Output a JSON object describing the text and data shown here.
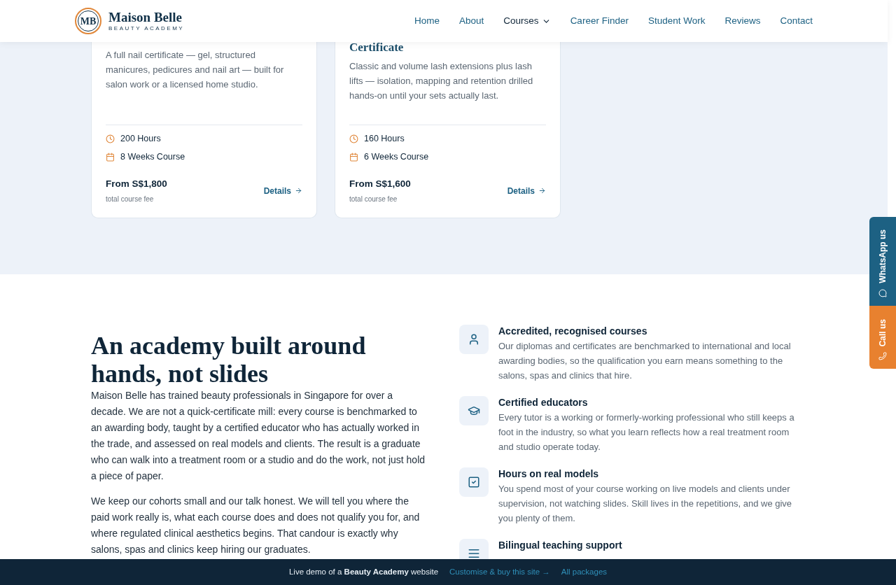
{
  "header": {
    "logo_mark": "MB",
    "brand": "Maison Belle",
    "tagline": "BEAUTY ACADEMY",
    "nav": [
      {
        "label": "Home",
        "selected": false,
        "dropdown": false
      },
      {
        "label": "About",
        "selected": false,
        "dropdown": false
      },
      {
        "label": "Courses",
        "selected": true,
        "dropdown": true
      },
      {
        "label": "Career Finder",
        "selected": false,
        "dropdown": false
      },
      {
        "label": "Student Work",
        "selected": false,
        "dropdown": false
      },
      {
        "label": "Reviews",
        "selected": false,
        "dropdown": false
      },
      {
        "label": "Contact",
        "selected": false,
        "dropdown": false
      }
    ]
  },
  "courses": [
    {
      "description": "A full nail certificate — gel, structured manicures, pedicures and nail art — built for salon work or a licensed home studio.",
      "hours": "200 Hours",
      "duration": "8 Weeks Course",
      "price": "From S$1,800",
      "price_note": "total course fee",
      "link": "Details"
    },
    {
      "title": "Certificate",
      "description": "Classic and volume lash extensions plus lash lifts — isolation, mapping and retention drilled hands-on until your sets actually last.",
      "hours": "160 Hours",
      "duration": "6 Weeks Course",
      "price": "From S$1,600",
      "price_note": "total course fee",
      "link": "Details"
    }
  ],
  "about": {
    "heading": "An academy built around hands, not slides",
    "paragraphs": [
      "Maison Belle has trained beauty professionals in Singapore for over a decade. We are not a quick-certificate mill: every course is benchmarked to an awarding body, taught by a certified educator who has actually worked in the trade, and assessed on real models and clients. The result is a graduate who can walk into a treatment room or a studio and do the work, not just hold a piece of paper.",
      "We keep our cohorts small and our talk honest. We will tell you where the paid work really is, what each course does and does not qualify you for, and where regulated clinical aesthetics begins. That candour is exactly why salons, spas and clinics keep hiring our graduates."
    ],
    "features": [
      {
        "kind": "person",
        "title": "Accredited, recognised courses",
        "text": "Our diplomas and certificates are benchmarked to international and local awarding bodies, so the qualification you earn means something to the salons, spas and clinics that hire."
      },
      {
        "kind": "cap",
        "title": "Certified educators",
        "text": "Every tutor is a working or formerly-working professional who still keeps a foot in the industry, so what you learn reflects how a real treatment room and studio operate today."
      },
      {
        "kind": "check",
        "title": "Hours on real models",
        "text": "You spend most of your course working on live models and clients under supervision, not watching slides. Skill lives in the repetitions, and we give you plenty of them."
      },
      {
        "kind": "lines",
        "title": "Bilingual teaching support"
      }
    ]
  },
  "side_tabs": [
    {
      "kind": "whatsapp",
      "label": "WhatsApp us"
    },
    {
      "kind": "call",
      "label": "Call us"
    }
  ],
  "demo_bar": {
    "text": "Live demo of a **Beauty Academy** website",
    "links": [
      "Customise & buy this site →",
      "All packages"
    ]
  }
}
